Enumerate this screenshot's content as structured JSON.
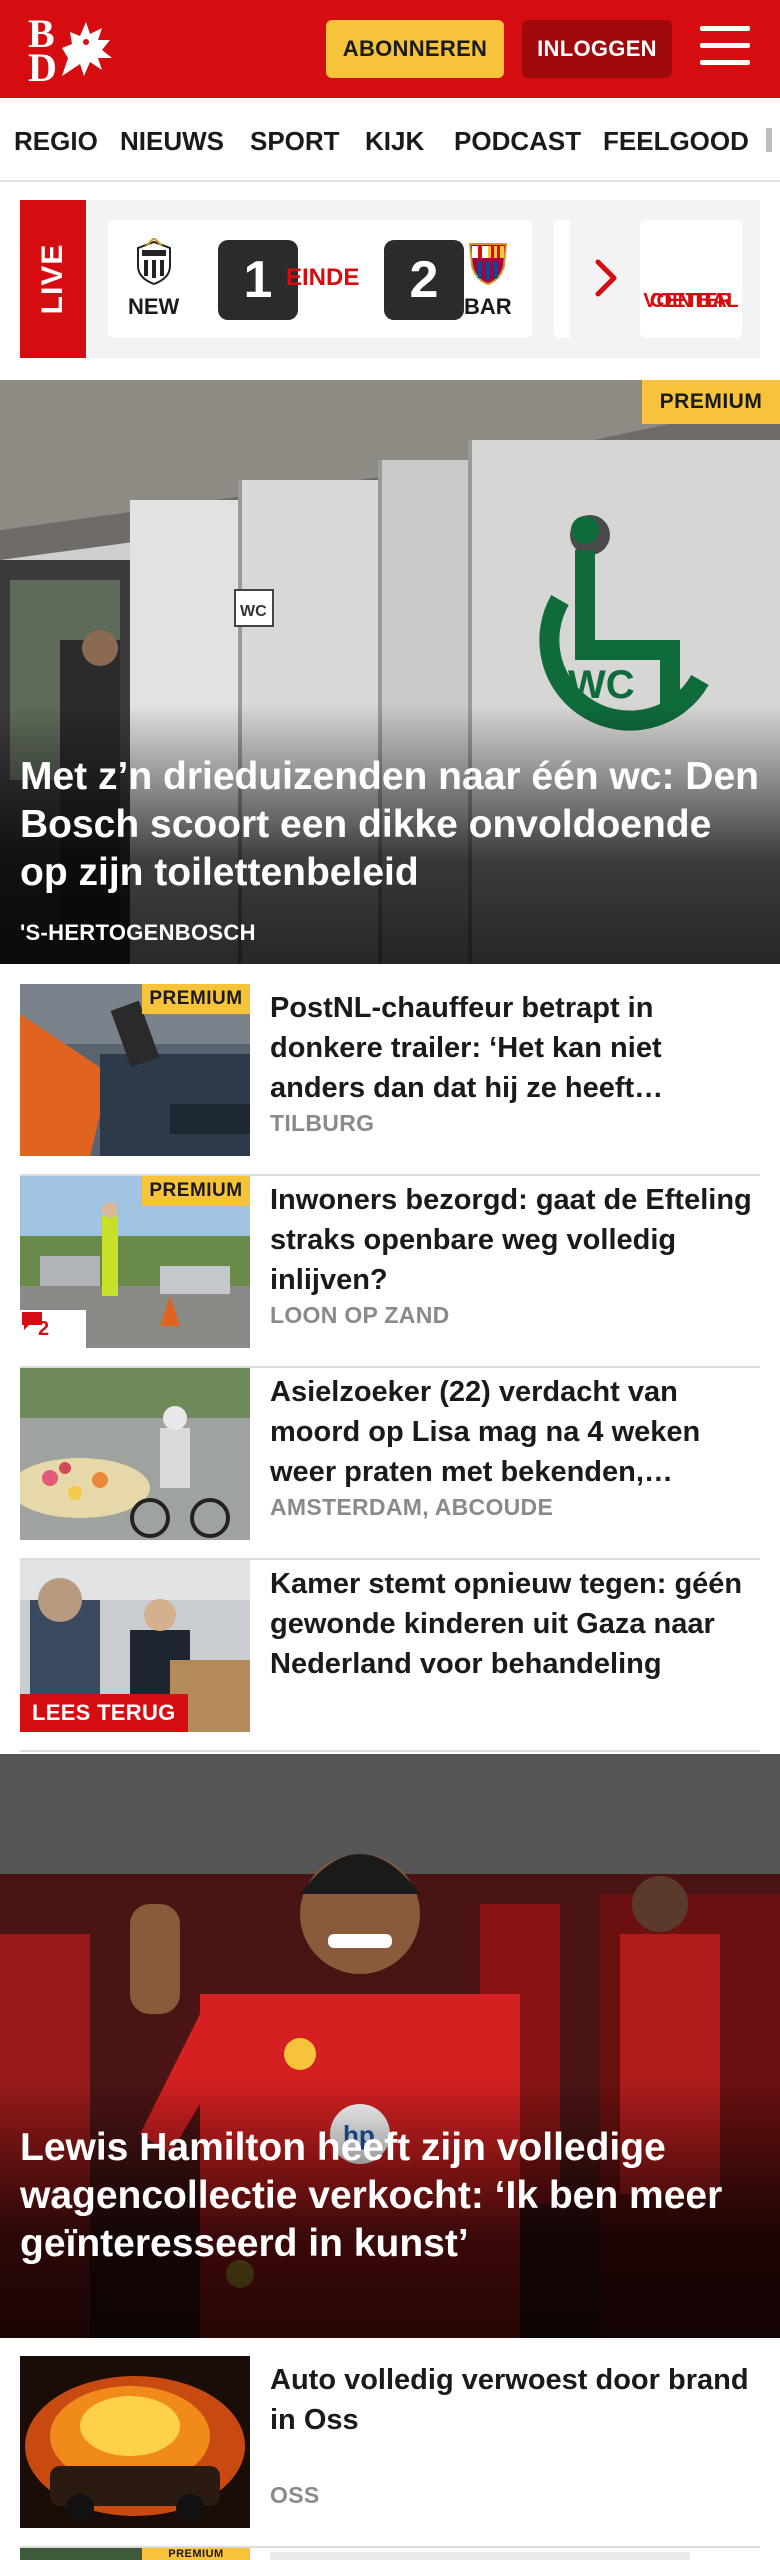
{
  "header": {
    "logo_letters": [
      "B",
      "D"
    ],
    "subscribe_label": "ABONNEREN",
    "login_label": "INLOGGEN",
    "menu_icon": "hamburger-icon",
    "brand_color": "#d50d11"
  },
  "nav": {
    "items": [
      "REGIO",
      "NIEUWS",
      "SPORT",
      "KIJK",
      "PODCAST",
      "FEELGOOD"
    ]
  },
  "live": {
    "label": "LIVE",
    "match": {
      "home_team": "NEW",
      "away_team": "BAR",
      "home_score": "1",
      "away_score": "2",
      "status": "EINDE"
    },
    "cta_line1": "VOETBAL",
    "cta_line2": "CENTER"
  },
  "hero": {
    "badge": "PREMIUM",
    "title": "Met z’n drieduizenden naar één wc: Den Bosch scoort een dikke onvoldoende op zijn toilettenbeleid",
    "location": "'S-HERTOGENBOSCH"
  },
  "articles": [
    {
      "title": "PostNL-chauffeur betrapt in donkere trailer: ‘Het kan niet anders dan dat hij ze heeft…",
      "location": "TILBURG",
      "badge": "PREMIUM"
    },
    {
      "title": "Inwoners bezorgd: gaat de Efteling straks openbare weg volledig inlijven?",
      "location": "LOON OP ZAND",
      "badge": "PREMIUM",
      "comments": "2"
    },
    {
      "title": "Asielzoeker (22) verdacht van moord op Lisa mag na 4 weken weer praten met bekenden,…",
      "location": "AMSTERDAM, ABCOUDE"
    },
    {
      "title": "Kamer stemt opnieuw tegen: géén gewonde kinderen uit Gaza naar Nederland voor behandeling",
      "tag": "LEES TERUG"
    }
  ],
  "hero2": {
    "title": "Lewis Hamilton heeft zijn volledige wagencollectie verkocht: ‘Ik ben meer geïnteresseerd in kunst’"
  },
  "articles2": [
    {
      "title": "Auto volledig verwoest door brand in Oss",
      "location": "OSS"
    },
    {
      "badge": "PREMIUM"
    }
  ]
}
